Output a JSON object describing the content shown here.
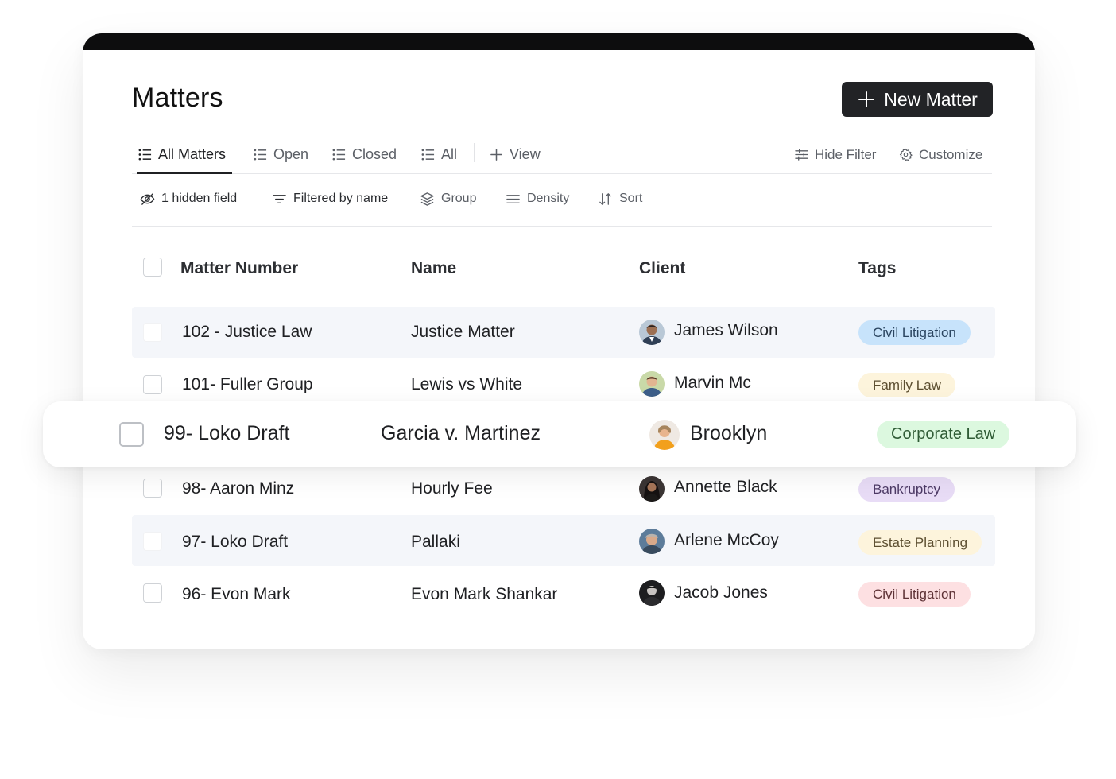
{
  "header": {
    "title": "Matters",
    "new_button_label": "New Matter"
  },
  "tabs": [
    {
      "label": "All Matters",
      "icon": "list-icon",
      "active": true
    },
    {
      "label": "Open",
      "icon": "list-icon"
    },
    {
      "label": "Closed",
      "icon": "list-icon"
    },
    {
      "label": "All",
      "icon": "list-icon"
    },
    {
      "label": "View",
      "icon": "plus-icon"
    }
  ],
  "tab_actions": {
    "hide_filter": "Hide Filter",
    "customize": "Customize"
  },
  "toolbar": {
    "hidden_field": "1 hidden field",
    "filtered": "Filtered by name",
    "group": "Group",
    "density": "Density",
    "sort": "Sort"
  },
  "table": {
    "columns": [
      "Matter Number",
      "Name",
      "Client",
      "Tags"
    ],
    "rows": [
      {
        "number": "102 - Justice Law",
        "name": "Justice Matter",
        "client": "James Wilson",
        "tag": "Civil Litigation",
        "tag_bg": "#c7e3fb",
        "tag_fg": "#2b4560"
      },
      {
        "number": "101- Fuller Group",
        "name": "Lewis vs White",
        "client": "Marvin Mc",
        "tag": "Family Law",
        "tag_bg": "#fdf4dc",
        "tag_fg": "#5c4e30"
      },
      {
        "number": "99- Loko Draft",
        "name": "Garcia v. Martinez",
        "client": "Brooklyn",
        "tag": "Corporate Law",
        "tag_bg": "#dcf8df",
        "tag_fg": "#2f5b35"
      },
      {
        "number": "98- Aaron Minz",
        "name": "Hourly Fee",
        "client": "Annette Black",
        "tag": "Bankruptcy",
        "tag_bg": "#e8dcf6",
        "tag_fg": "#4d3a66"
      },
      {
        "number": "97- Loko Draft",
        "name": "Pallaki",
        "client": "Arlene McCoy",
        "tag": "Estate Planning",
        "tag_bg": "#fdf4dc",
        "tag_fg": "#5c4e30"
      },
      {
        "number": "96- Evon Mark",
        "name": "Evon Mark  Shankar",
        "client": "Jacob Jones",
        "tag": "Civil Litigation",
        "tag_bg": "#fde0e2",
        "tag_fg": "#5e3236"
      }
    ]
  }
}
